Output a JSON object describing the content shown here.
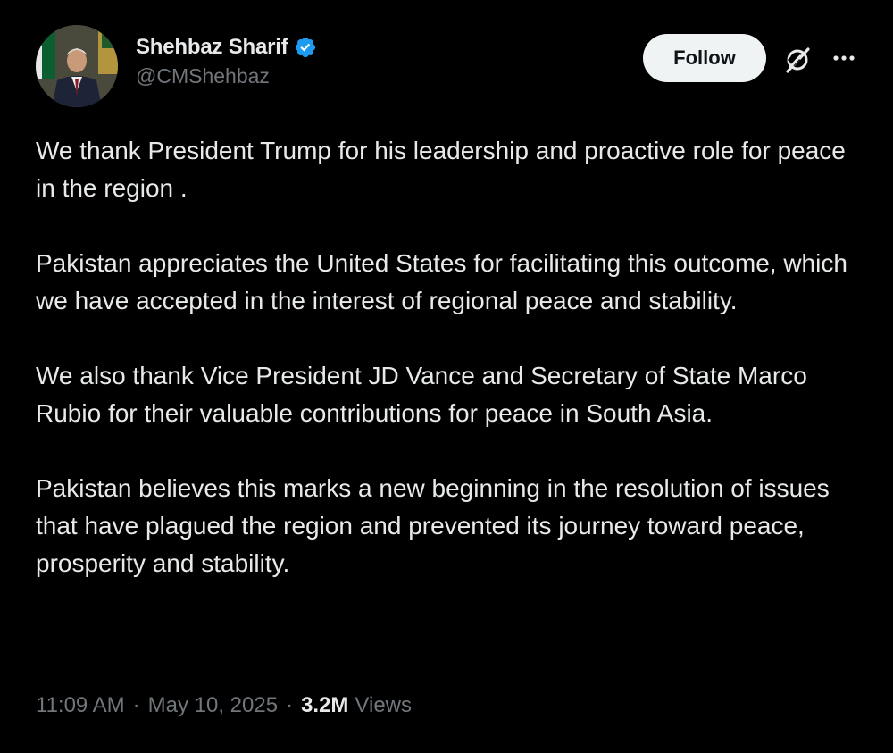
{
  "author": {
    "display_name": "Shehbaz Sharif",
    "handle": "@CMShehbaz",
    "verified": true
  },
  "actions": {
    "follow_label": "Follow",
    "grok_icon": "grok-icon",
    "more_icon": "more-icon"
  },
  "tweet": {
    "paragraphs": [
      "We thank President Trump for his leadership and proactive role for peace in the region .",
      "Pakistan appreciates the United States for facilitating this outcome, which we have accepted in the interest of regional peace and stability.",
      "We also thank Vice President JD Vance and Secretary of State Marco Rubio for their valuable contributions for peace in South Asia.",
      "Pakistan believes this marks a new beginning in the resolution of issues that have plagued the region and prevented its journey toward peace, prosperity and stability."
    ]
  },
  "meta": {
    "time": "11:09 AM",
    "date": "May 10, 2025",
    "separator": "·",
    "views_count": "3.2M",
    "views_label": "Views"
  },
  "colors": {
    "background": "#000000",
    "text_primary": "#e7e9ea",
    "text_secondary": "#71767b",
    "verified_blue": "#1d9bf0",
    "follow_bg": "#eff3f4",
    "follow_text": "#0f1419"
  }
}
